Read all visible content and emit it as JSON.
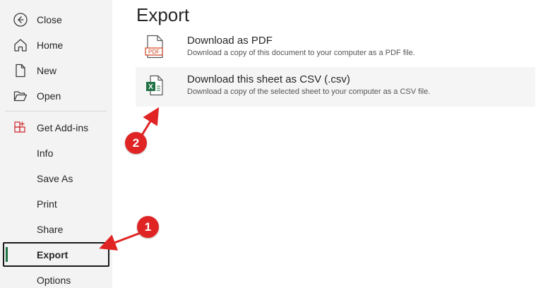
{
  "sidebar": {
    "items": [
      {
        "label": "Close",
        "icon": "back-arrow-icon"
      },
      {
        "label": "Home",
        "icon": "home-icon"
      },
      {
        "label": "New",
        "icon": "new-document-icon"
      },
      {
        "label": "Open",
        "icon": "folder-open-icon"
      },
      {
        "label": "Get Add-ins",
        "icon": "add-ins-icon"
      },
      {
        "label": "Info"
      },
      {
        "label": "Save As"
      },
      {
        "label": "Print"
      },
      {
        "label": "Share"
      },
      {
        "label": "Export",
        "active": true
      },
      {
        "label": "Options"
      }
    ]
  },
  "main": {
    "title": "Export",
    "options": [
      {
        "title": "Download as PDF",
        "description": "Download a copy of this document to your computer as a PDF file.",
        "icon": "pdf-file-icon",
        "icon_text": "PDF"
      },
      {
        "title": "Download this sheet as CSV (.csv)",
        "description": "Download a copy of the selected sheet to your computer as a CSV file.",
        "icon": "excel-csv-file-icon",
        "icon_text": "X"
      }
    ]
  },
  "annotations": {
    "step1": "1",
    "step2": "2"
  },
  "colors": {
    "accent_green": "#217346",
    "addins_red": "#d13438",
    "pdf_red": "#d04423",
    "annotation_red": "#e02424"
  }
}
